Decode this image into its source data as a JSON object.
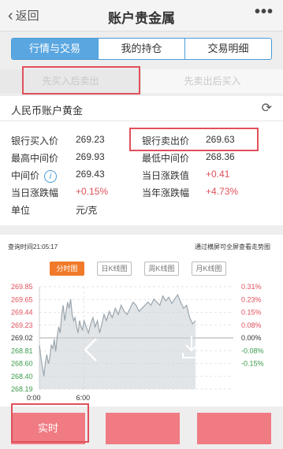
{
  "nav": {
    "back_label": "返回",
    "title": "账户贵金属",
    "more_label": "•••"
  },
  "segment": {
    "tabs": [
      {
        "label": "行情与交易",
        "active": true
      },
      {
        "label": "我的持仓",
        "active": false
      },
      {
        "label": "交易明细",
        "active": false
      }
    ]
  },
  "subtabs": {
    "left": "先买入后卖出",
    "right": "先卖出后买入"
  },
  "product": {
    "name": "人民币账户黄金",
    "refresh_icon": "refresh-icon"
  },
  "quotes": {
    "bank_buy_label": "银行买入价",
    "bank_buy": "269.23",
    "bank_sell_label": "银行卖出价",
    "bank_sell": "269.63",
    "high_mid_label": "最高中间价",
    "high_mid": "269.93",
    "low_mid_label": "最低中间价",
    "low_mid": "268.36",
    "mid_label": "中间价",
    "mid": "269.43",
    "day_change_label": "当日涨跌值",
    "day_change": "+0.41",
    "day_pct_label": "当日涨跌幅",
    "day_pct": "+0.15%",
    "year_pct_label": "当年涨跌幅",
    "year_pct": "+4.73%",
    "unit_label": "单位",
    "unit": "元/克"
  },
  "chart_header": {
    "query_time": "查询时间21:05:17",
    "hint": "通过横屏可全屏查看走势图",
    "tabs": [
      "分时图",
      "日K线图",
      "周K线图",
      "月K线图"
    ],
    "active_tab": 0
  },
  "chart_data": {
    "type": "line",
    "y_ticks": [
      "269.85",
      "269.65",
      "269.44",
      "269.23",
      "269.02",
      "268.81",
      "268.60",
      "268.40",
      "268.19"
    ],
    "pct_ticks": [
      "0.31%",
      "0.23%",
      "0.15%",
      "0.08%",
      "0.00%",
      "-0.08%",
      "-0.15%"
    ],
    "x_ticks": [
      "0:00",
      "6:00"
    ],
    "ylim": [
      268.19,
      269.85
    ],
    "baseline": 269.02,
    "x_range": [
      0,
      24
    ],
    "x": [
      0,
      0.2,
      0.4,
      0.6,
      0.8,
      1.0,
      1.2,
      1.4,
      1.6,
      1.8,
      2.0,
      2.2,
      2.4,
      2.6,
      2.8,
      3.0,
      3.2,
      3.4,
      3.6,
      3.8,
      4.0,
      4.2,
      4.4,
      4.6,
      4.8,
      5.0,
      5.2,
      5.4,
      5.6,
      5.8,
      6.0,
      6.3,
      6.6,
      6.9,
      7.2,
      7.5,
      7.8,
      8.1,
      8.4,
      8.7,
      9.0,
      9.4,
      9.8,
      10.2,
      10.6,
      11.0,
      11.4,
      11.8,
      12.2,
      12.6,
      13.0,
      13.4,
      13.8,
      14.2,
      14.6,
      15.0,
      15.4,
      15.8,
      16.2,
      16.6,
      17.0,
      17.4,
      17.8,
      18.2,
      18.6,
      19.0,
      19.4,
      19.8,
      20.2,
      20.6,
      21.0
    ],
    "y": [
      268.9,
      268.7,
      268.55,
      268.4,
      268.62,
      268.75,
      268.6,
      268.7,
      268.9,
      268.85,
      269.0,
      268.8,
      269.05,
      269.2,
      269.1,
      269.4,
      269.55,
      269.3,
      269.45,
      269.6,
      269.5,
      269.65,
      269.4,
      269.3,
      269.35,
      269.2,
      269.1,
      269.3,
      269.2,
      269.15,
      269.3,
      269.2,
      269.1,
      269.25,
      269.35,
      269.2,
      269.3,
      269.1,
      269.25,
      269.4,
      269.3,
      269.45,
      269.35,
      269.5,
      269.4,
      269.55,
      269.45,
      269.4,
      269.5,
      269.6,
      269.55,
      269.45,
      269.5,
      269.55,
      269.6,
      269.55,
      269.65,
      269.6,
      269.55,
      269.7,
      269.62,
      269.68,
      269.58,
      269.65,
      269.72,
      269.6,
      269.5,
      269.55,
      269.35,
      269.25,
      269.3
    ]
  },
  "colors": {
    "accent_blue": "#4a9bd8",
    "up_red": "#e0505a",
    "line_gray": "#9aa5ad",
    "fill_gray": "#c9d0d6",
    "orange": "#f07a2a",
    "button_pink": "#f07b83"
  },
  "bottom": {
    "realtime_label": "实时"
  }
}
